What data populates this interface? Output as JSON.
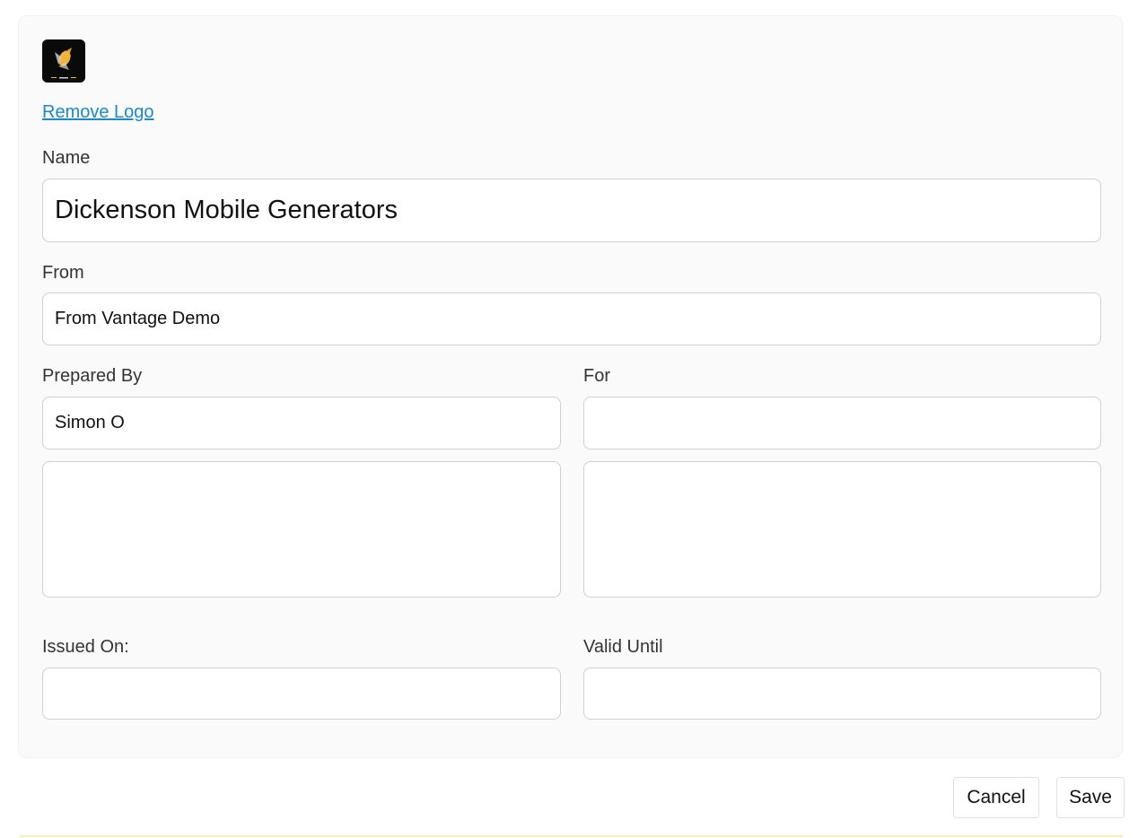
{
  "logo": {
    "icon": "bird-logo-icon",
    "background": "#0a0a0a",
    "accent": "#f2b33d"
  },
  "actions": {
    "remove_logo": "Remove Logo"
  },
  "fields": {
    "name": {
      "label": "Name",
      "value": "Dickenson Mobile Generators"
    },
    "from": {
      "label": "From",
      "value": "From Vantage Demo"
    },
    "prepared_by": {
      "label": "Prepared By",
      "value": "Simon O",
      "details": ""
    },
    "for": {
      "label": "For",
      "value": "",
      "details": ""
    },
    "issued_on": {
      "label": "Issued On:",
      "value": ""
    },
    "valid_until": {
      "label": "Valid Until",
      "value": ""
    }
  },
  "buttons": {
    "cancel": "Cancel",
    "save": "Save"
  },
  "colors": {
    "link": "#1a8ac6",
    "panel": "#fafafa",
    "border": "#cfcfd4"
  }
}
